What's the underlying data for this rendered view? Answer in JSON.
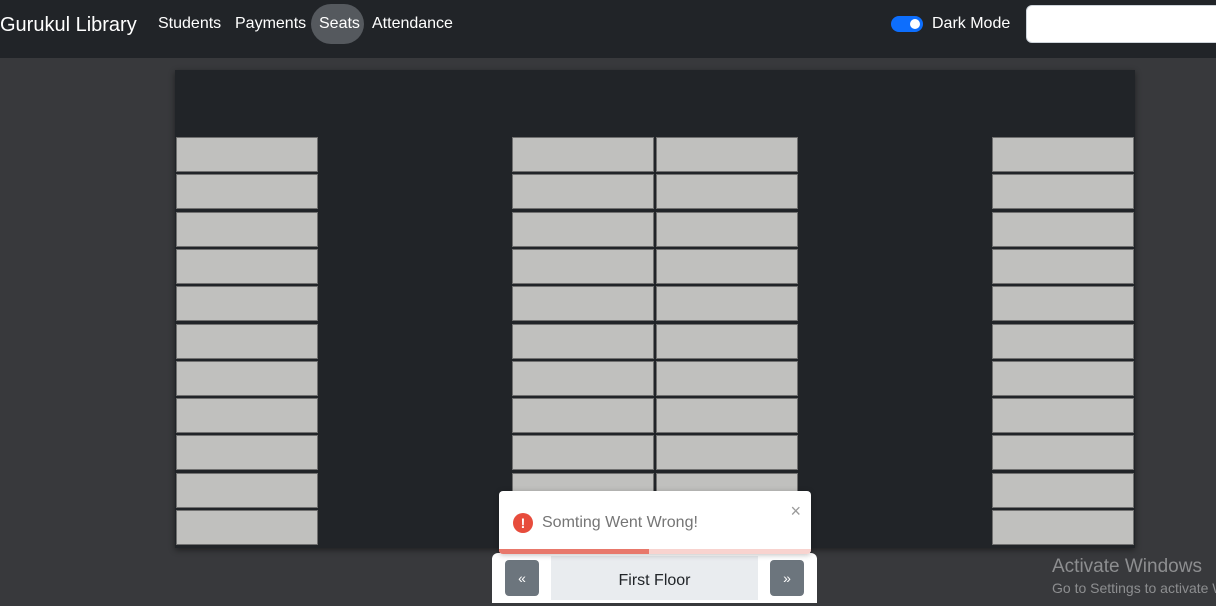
{
  "navbar": {
    "brand": "Gurukul Library",
    "links": [
      {
        "label": "Students",
        "active": false
      },
      {
        "label": "Payments",
        "active": false
      },
      {
        "label": "Seats",
        "active": true
      },
      {
        "label": "Attendance",
        "active": false
      }
    ],
    "dark_mode": {
      "label": "Dark Mode",
      "enabled": true
    },
    "search": {
      "value": "",
      "placeholder": ""
    }
  },
  "floor_map": {
    "seat_columns": 4,
    "seats_per_column": 11,
    "seat_color": "#c0c0be",
    "background_color": "#212428"
  },
  "pager": {
    "prev_label": "«",
    "current_floor": "First Floor",
    "next_label": "»"
  },
  "toast": {
    "icon": "exclamation-icon",
    "message": "Somting Went Wrong!",
    "close_label": "×",
    "progress": 0.48
  },
  "watermark": {
    "title": "Activate Windows",
    "subtitle": "Go to Settings to activate Windows."
  }
}
